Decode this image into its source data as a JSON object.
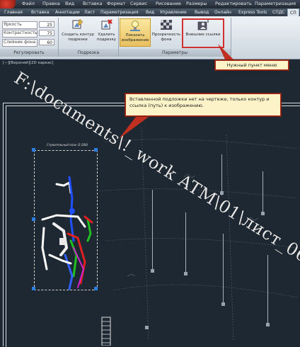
{
  "menu": {
    "items": [
      "Файл",
      "Правка",
      "Вид",
      "Вставка",
      "Формат",
      "Сервис",
      "Рисование",
      "Размеры",
      "Редактировать",
      "Параметризация"
    ]
  },
  "tabs": {
    "items": [
      "Главная",
      "Вставка",
      "Аннотации",
      "Лист",
      "Параметризация",
      "Вид",
      "Управление",
      "Вывод",
      "Онлайн",
      "Express Tools",
      "СПДС",
      "СП"
    ],
    "active_index": 11
  },
  "ribbon": {
    "sliders": [
      {
        "label": "Яркость",
        "value": "25"
      },
      {
        "label": "Контрастность",
        "value": "75"
      },
      {
        "label": "Слияние фона",
        "value": "60"
      }
    ],
    "groups": [
      "Регулировать",
      "Подрезка",
      "Параметры"
    ],
    "buttons": {
      "create_clip": "Создать контур подрезки",
      "delete_clip": "Удалить подрезку",
      "show_image": "Показать изображение",
      "bg_transparency": "Прозрачность фона",
      "external_refs": "Внешние ссылки"
    }
  },
  "viewport": {
    "label": "[−][Верхний][2D каркас]"
  },
  "drawing": {
    "plan_title": "Строительный план (1:200)"
  },
  "callouts": {
    "menu_item": "Нужный пункт меню",
    "note": "Вставленной подложки нет на чертеже, только контур и ссылка (путь) к изображению."
  },
  "watermark": "F:\\documents\\!_work ATM\\01\\лист_06.jpg",
  "colors": {
    "canvas": "#1e2832",
    "callout_bg": "#fdf3c8",
    "callout_border": "#b03020",
    "grip": "#2a7fe0"
  }
}
